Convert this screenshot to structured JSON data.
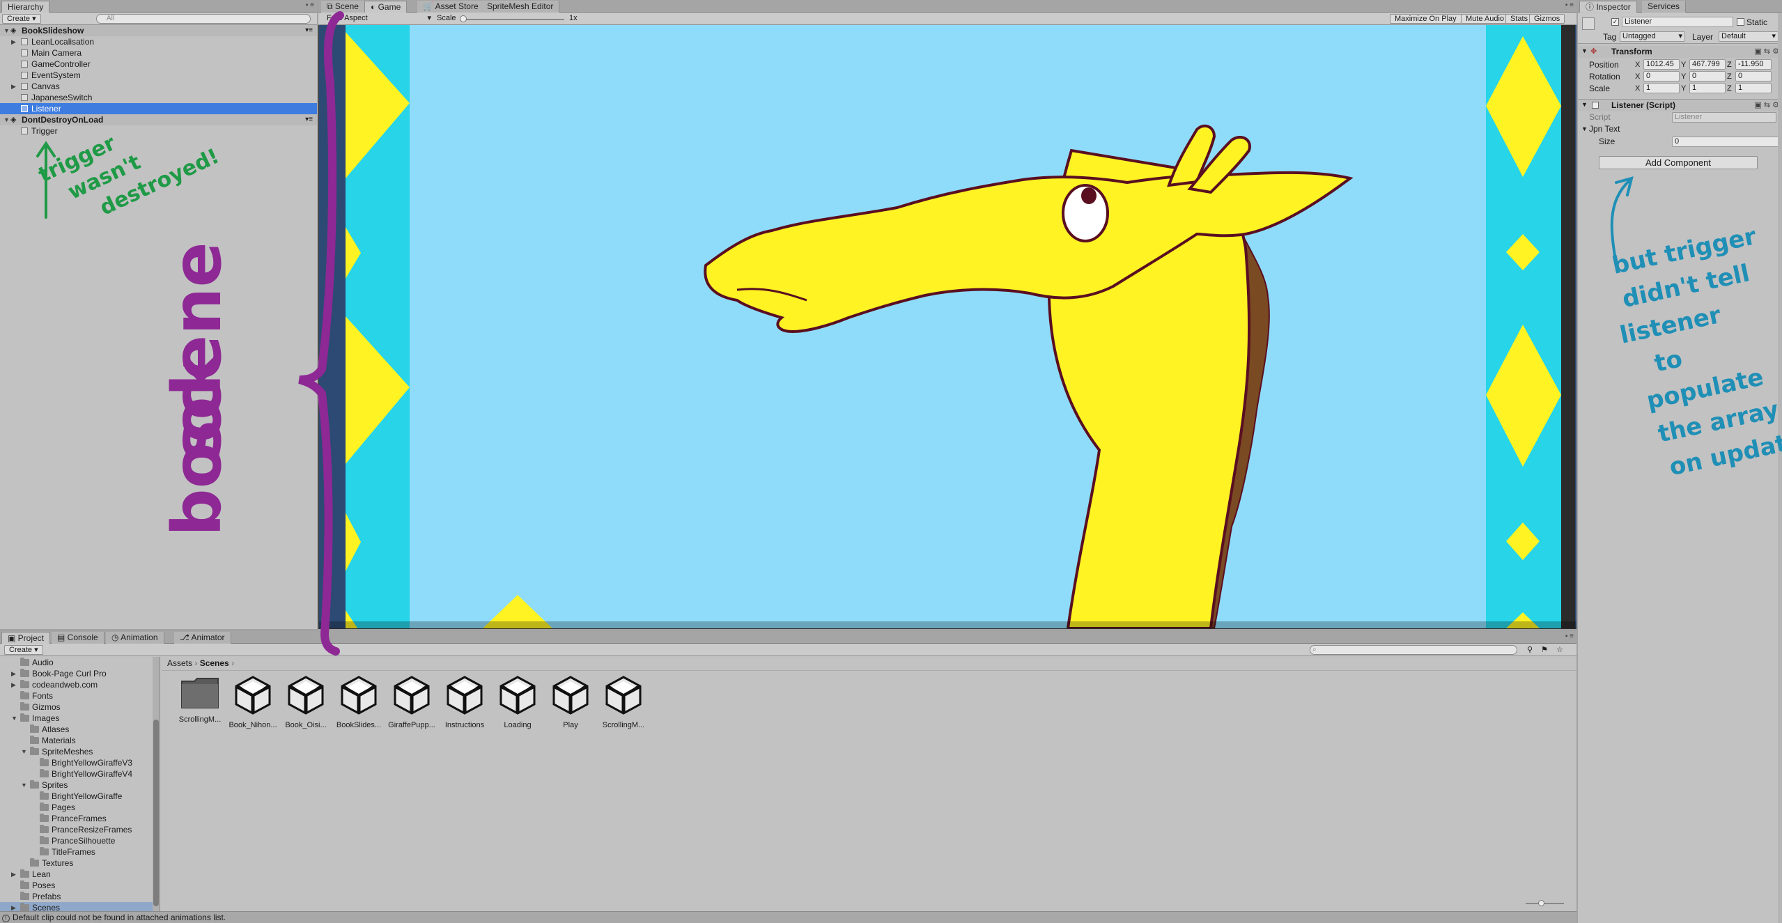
{
  "hierarchy": {
    "tab": "Hierarchy",
    "create": "Create",
    "search_placeholder": "All",
    "scenes": [
      {
        "name": "BookSlideshow",
        "items": [
          "LeanLocalisation",
          "Main Camera",
          "GameController",
          "EventSystem",
          "Canvas",
          "JapaneseSwitch",
          "Listener"
        ]
      },
      {
        "name": "DontDestroyOnLoad",
        "items": [
          "Trigger"
        ]
      }
    ]
  },
  "game": {
    "tabs": [
      "Scene",
      "Game",
      "Asset Store",
      "SpriteMesh Editor"
    ],
    "aspect": "Free Aspect",
    "scale_label": "Scale",
    "scale_value": "1x",
    "toggles": [
      "Maximize On Play",
      "Mute Audio",
      "Stats",
      "Gizmos"
    ]
  },
  "inspector": {
    "tabs": [
      "Inspector",
      "Services"
    ],
    "object_name": "Listener",
    "static_label": "Static",
    "tag_label": "Tag",
    "tag_value": "Untagged",
    "layer_label": "Layer",
    "layer_value": "Default",
    "transform": {
      "title": "Transform",
      "position": {
        "label": "Position",
        "x": "1012.45",
        "y": "467.799",
        "z": "-11.950"
      },
      "rotation": {
        "label": "Rotation",
        "x": "0",
        "y": "0",
        "z": "0"
      },
      "scale": {
        "label": "Scale",
        "x": "1",
        "y": "1",
        "z": "1"
      }
    },
    "script_component": {
      "title": "Listener (Script)",
      "script_label": "Script",
      "script_value": "Listener",
      "jpn_text_label": "Jpn Text",
      "size_label": "Size",
      "size_value": "0"
    },
    "add_component": "Add Component"
  },
  "project": {
    "tabs": [
      "Project",
      "Console",
      "Animation",
      "Animator"
    ],
    "create": "Create",
    "breadcrumb": [
      "Assets",
      "Scenes"
    ],
    "tree": [
      {
        "label": "Audio",
        "depth": 1,
        "arrow": ""
      },
      {
        "label": "Book-Page Curl Pro",
        "depth": 1,
        "arrow": "▶"
      },
      {
        "label": "codeandweb.com",
        "depth": 1,
        "arrow": "▶"
      },
      {
        "label": "Fonts",
        "depth": 1,
        "arrow": ""
      },
      {
        "label": "Gizmos",
        "depth": 1,
        "arrow": ""
      },
      {
        "label": "Images",
        "depth": 1,
        "arrow": "▼"
      },
      {
        "label": "Atlases",
        "depth": 2,
        "arrow": ""
      },
      {
        "label": "Materials",
        "depth": 2,
        "arrow": ""
      },
      {
        "label": "SpriteMeshes",
        "depth": 2,
        "arrow": "▼"
      },
      {
        "label": "BrightYellowGiraffeV3",
        "depth": 3,
        "arrow": ""
      },
      {
        "label": "BrightYellowGiraffeV4",
        "depth": 3,
        "arrow": ""
      },
      {
        "label": "Sprites",
        "depth": 2,
        "arrow": "▼"
      },
      {
        "label": "BrightYellowGiraffe",
        "depth": 3,
        "arrow": ""
      },
      {
        "label": "Pages",
        "depth": 3,
        "arrow": ""
      },
      {
        "label": "PranceFrames",
        "depth": 3,
        "arrow": ""
      },
      {
        "label": "PranceResizeFrames",
        "depth": 3,
        "arrow": ""
      },
      {
        "label": "PranceSilhouette",
        "depth": 3,
        "arrow": ""
      },
      {
        "label": "TitleFrames",
        "depth": 3,
        "arrow": ""
      },
      {
        "label": "Textures",
        "depth": 2,
        "arrow": ""
      },
      {
        "label": "Lean",
        "depth": 1,
        "arrow": "▶"
      },
      {
        "label": "Poses",
        "depth": 1,
        "arrow": ""
      },
      {
        "label": "Prefabs",
        "depth": 1,
        "arrow": ""
      },
      {
        "label": "Scenes",
        "depth": 1,
        "arrow": "▶"
      }
    ],
    "assets": [
      "ScrollingM...",
      "Book_Nihon...",
      "Book_Oisi...",
      "BookSlides...",
      "GiraffePupp...",
      "Instructions",
      "Loading",
      "Play",
      "ScrollingM..."
    ]
  },
  "status": {
    "message": "Default clip could not be found in attached animations list."
  },
  "annotations": {
    "green": [
      "trigger",
      "wasn't",
      "destroyed!"
    ],
    "purple": [
      "book",
      "scene"
    ],
    "blue": [
      "but trigger",
      "didn't tell",
      "listener",
      "to",
      "populate",
      "the  array",
      "on update :("
    ]
  },
  "colors": {
    "selection": "#3e7ce0",
    "cyan": "#27d4e8",
    "sky": "#8fdcfa",
    "yellow": "#fff323",
    "outline": "#5a0f21",
    "mane": "#7a4a22",
    "ink_green": "#1f9a46",
    "ink_purple": "#8e2895",
    "ink_blue": "#1f8fb6"
  }
}
